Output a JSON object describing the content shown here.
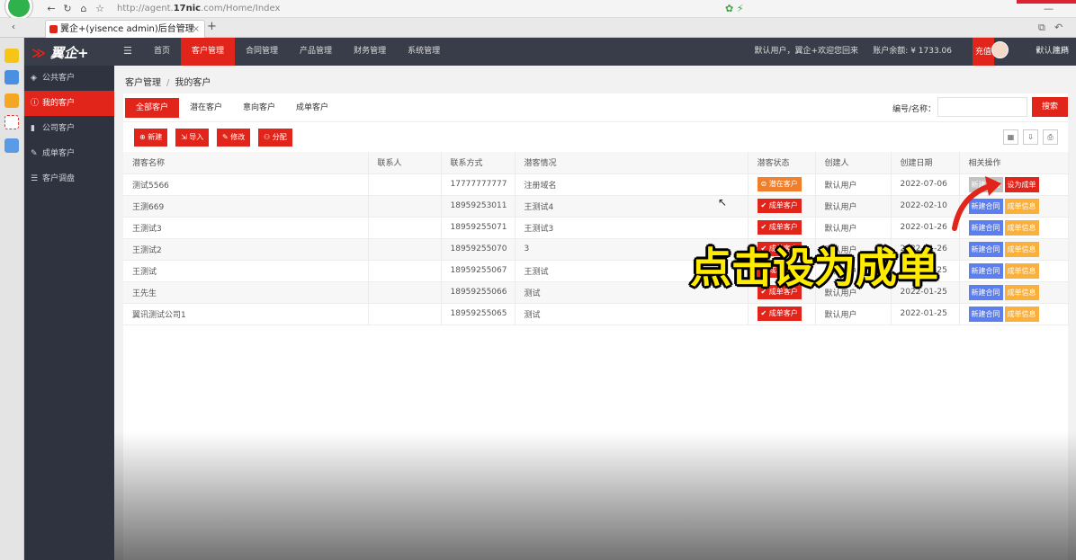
{
  "browser": {
    "url_prefix": "http://agent.",
    "url_host": "17nic",
    "url_suffix": ".com/Home/Index",
    "tab_title": "翼企+(yisence admin)后台管理",
    "tab_close": "×",
    "tab_add": "+"
  },
  "header": {
    "logo": "翼企+",
    "logo_mark": "≫",
    "nav": [
      "首页",
      "客户管理",
      "合同管理",
      "产品管理",
      "财务管理",
      "系统管理"
    ],
    "active_nav": "客户管理",
    "welcome": "默认用户，翼企+欢迎您回来",
    "balance_label": "账户余额: ¥ 1733.06",
    "charge": "充值",
    "user": "默认用户",
    "logout": "注销"
  },
  "sidebar": {
    "items": [
      {
        "label": "公共客户"
      },
      {
        "label": "我的客户"
      },
      {
        "label": "公司客户"
      },
      {
        "label": "成单客户"
      },
      {
        "label": "客户调盘"
      }
    ]
  },
  "breadcrumb": {
    "first": "客户管理",
    "sep": "/",
    "second": "我的客户"
  },
  "subtabs": [
    "全部客户",
    "潜在客户",
    "意向客户",
    "成单客户"
  ],
  "search": {
    "label": "编号/名称：",
    "placeholder": "",
    "button": "搜索"
  },
  "toolbar": {
    "add": "新建",
    "import": "导入",
    "edit": "修改",
    "assign": "分配"
  },
  "table": {
    "columns": [
      "潜客名称",
      "联系人",
      "联系方式",
      "潜客情况",
      "潜客状态",
      "创建人",
      "创建日期",
      "相关操作"
    ],
    "rows": [
      {
        "name": "测试5566",
        "contact": "",
        "phone": "17777777777",
        "situation": "注册域名",
        "status": "潜在客户",
        "creator": "默认用户",
        "date": "2022-07-06",
        "op1": "新建合同",
        "op2": "设为成单"
      },
      {
        "name": "王测669",
        "contact": "",
        "phone": "18959253011",
        "situation": "王测试4",
        "status": "成单客户",
        "creator": "默认用户",
        "date": "2022-02-10",
        "op1": "新建合同",
        "op2": "成单信息"
      },
      {
        "name": "王测试3",
        "contact": "",
        "phone": "18959255071",
        "situation": "王测试3",
        "status": "成单客户",
        "creator": "默认用户",
        "date": "2022-01-26",
        "op1": "新建合同",
        "op2": "成单信息"
      },
      {
        "name": "王测试2",
        "contact": "",
        "phone": "18959255070",
        "situation": "3",
        "status": "成单客户",
        "creator": "默认用户",
        "date": "2022-01-26",
        "op1": "新建合同",
        "op2": "成单信息"
      },
      {
        "name": "王测试",
        "contact": "",
        "phone": "18959255067",
        "situation": "王测试",
        "status": "成单客户",
        "creator": "默认用户",
        "date": "2022-01-25",
        "op1": "新建合同",
        "op2": "成单信息"
      },
      {
        "name": "王先生",
        "contact": "",
        "phone": "18959255066",
        "situation": "测试",
        "status": "成单客户",
        "creator": "默认用户",
        "date": "2022-01-25",
        "op1": "新建合同",
        "op2": "成单信息"
      },
      {
        "name": "翼讯测试公司1",
        "contact": "",
        "phone": "18959255065",
        "situation": "测试",
        "status": "成单客户",
        "creator": "默认用户",
        "date": "2022-01-25",
        "op1": "新建合同",
        "op2": "成单信息"
      }
    ]
  },
  "overlay": {
    "caption": "点击设为成单"
  },
  "colors": {
    "accent": "#e1251b",
    "header_bg": "#393d49",
    "sidebar_bg": "#2f3340",
    "blue": "#5b7ff0",
    "yellow": "#fbb03b"
  }
}
